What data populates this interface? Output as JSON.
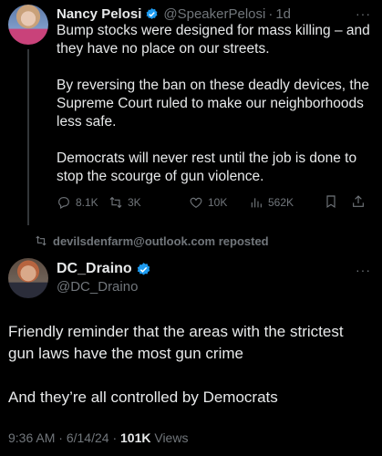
{
  "tweet1": {
    "name": "Nancy Pelosi",
    "handle": "@SpeakerPelosi",
    "separator": "·",
    "time": "1d",
    "more": "···",
    "paragraphs": [
      "Bump stocks were designed for mass killing – and they have no place on our streets.",
      "By reversing the ban on these deadly devices, the Supreme Court ruled to make our neighborhoods less safe.",
      "Democrats will never rest until the job is done to stop the scourge of gun violence."
    ],
    "actions": {
      "replies": "8.1K",
      "reposts": "3K",
      "likes": "10K",
      "views": "562K"
    }
  },
  "repost": {
    "text": "devilsdenfarm@outlook.com reposted"
  },
  "tweet2": {
    "name": "DC_Draino",
    "handle": "@DC_Draino",
    "more": "···",
    "paragraphs": [
      "Friendly reminder that the areas with the strictest gun laws have the most gun crime",
      "And they’re all controlled by Democrats"
    ],
    "time": "9:36 AM",
    "date": "6/14/24",
    "views_count": "101K",
    "views_label": "Views",
    "separator": "·"
  },
  "colors": {
    "background": "#000000",
    "text": "#e7e9ea",
    "secondary": "#71767b",
    "verified": "#1d9bf0"
  }
}
